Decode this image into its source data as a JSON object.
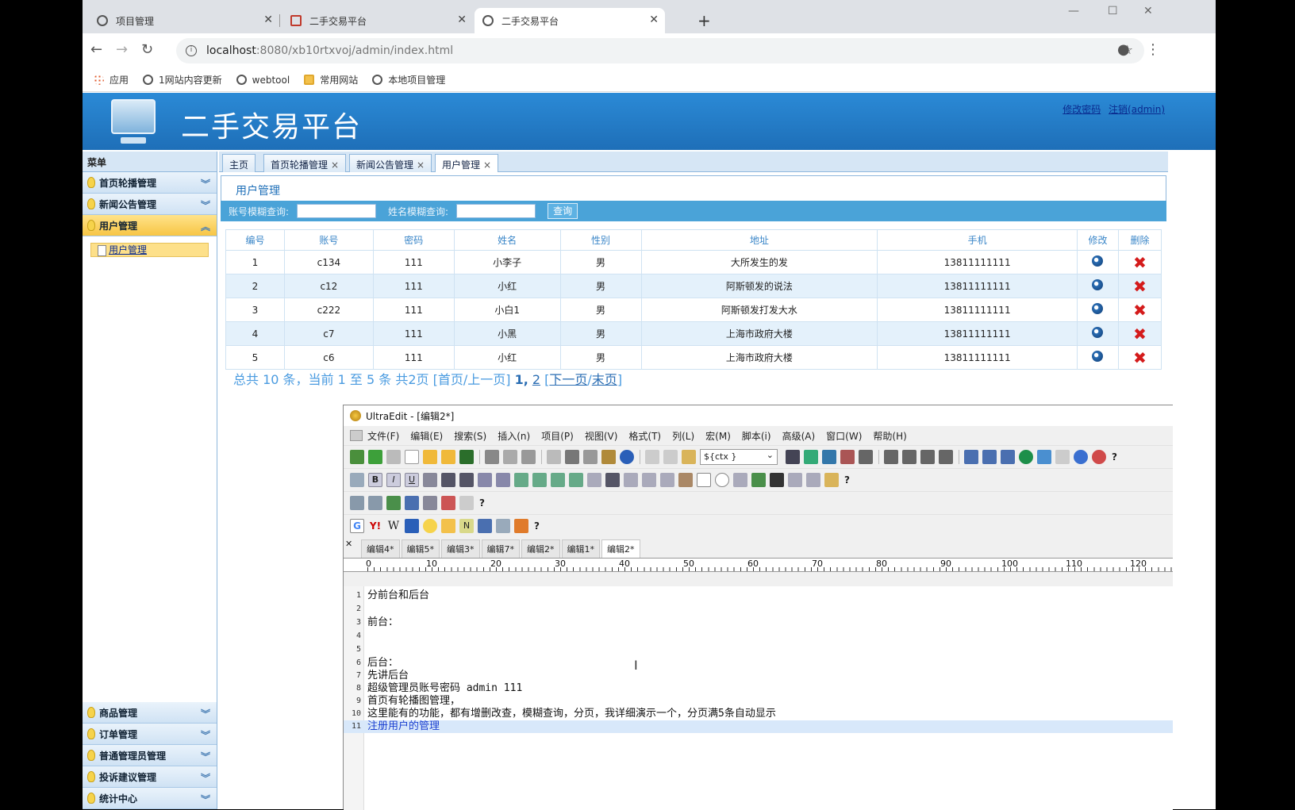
{
  "browser": {
    "tabs": [
      {
        "title": "项目管理"
      },
      {
        "title": "二手交易平台"
      },
      {
        "title": "二手交易平台"
      }
    ],
    "url_host": "localhost",
    "url_path": ":8080/xb10rtxvoj/admin/index.html",
    "bookmarks": [
      "应用",
      "1网站内容更新",
      "webtool",
      "常用网站",
      "本地项目管理"
    ]
  },
  "header": {
    "title": "二手交易平台",
    "link_change_password": "修改密码",
    "link_logout": "注销(admin)"
  },
  "sidebar": {
    "title": "菜单",
    "top_items": [
      {
        "label": "首页轮播管理"
      },
      {
        "label": "新闻公告管理"
      },
      {
        "label": "用户管理"
      }
    ],
    "sub_item": "用户管理",
    "bottom_items": [
      {
        "label": "商品管理"
      },
      {
        "label": "订单管理"
      },
      {
        "label": "普通管理员管理"
      },
      {
        "label": "投诉建议管理"
      },
      {
        "label": "统计中心"
      }
    ]
  },
  "page_tabs": [
    {
      "label": "主页"
    },
    {
      "label": "首页轮播管理"
    },
    {
      "label": "新闻公告管理"
    },
    {
      "label": "用户管理"
    }
  ],
  "panel": {
    "title": "用户管理",
    "search_account_label": "账号模糊查询:",
    "search_name_label": "姓名模糊查询:",
    "search_button": "查询"
  },
  "table": {
    "headers": [
      "编号",
      "账号",
      "密码",
      "姓名",
      "性别",
      "地址",
      "手机",
      "修改",
      "删除"
    ],
    "rows": [
      [
        "1",
        "c134",
        "111",
        "小李子",
        "男",
        "大所发生的发",
        "13811111111"
      ],
      [
        "2",
        "c12",
        "111",
        "小红",
        "男",
        "阿斯顿发的说法",
        "13811111111"
      ],
      [
        "3",
        "c222",
        "111",
        "小白1",
        "男",
        "阿斯顿发打发大水",
        "13811111111"
      ],
      [
        "4",
        "c7",
        "111",
        "小黑",
        "男",
        "上海市政府大楼",
        "13811111111"
      ],
      [
        "5",
        "c6",
        "111",
        "小红",
        "男",
        "上海市政府大楼",
        "13811111111"
      ]
    ]
  },
  "pagination": {
    "summary": "总共 10 条，当前 1 至 5 条 共2页 [首页/上一页]",
    "page1": "1",
    "page2": "2",
    "next": "下一页",
    "last": "末页"
  },
  "ultraedit": {
    "title": "UltraEdit - [编辑2*]",
    "menu": [
      "文件(F)",
      "编辑(E)",
      "搜索(S)",
      "插入(n)",
      "项目(P)",
      "视图(V)",
      "格式(T)",
      "列(L)",
      "宏(M)",
      "脚本(i)",
      "高级(A)",
      "窗口(W)",
      "帮助(H)"
    ],
    "combo_value": "${ctx }",
    "tabs": [
      "编辑4*",
      "编辑5*",
      "编辑3*",
      "编辑7*",
      "编辑2*",
      "编辑1*",
      "编辑2*"
    ],
    "ruler_ticks": [
      "0",
      "10",
      "20",
      "30",
      "40",
      "50",
      "60",
      "70",
      "80",
      "90",
      "100",
      "110",
      "120"
    ],
    "lines": [
      "分前台和后台",
      "",
      "前台：",
      "",
      "",
      "后台：",
      "先讲后台",
      "超级管理员账号密码 admin 111",
      "首页有轮播图管理，",
      "这里能有的功能，都有增删改查，模糊查询，分页，我详细演示一个，分页满5条自动显示",
      "注册用户的管理"
    ],
    "line_numbers": [
      "1",
      "2",
      "3",
      "4",
      "5",
      "6",
      "7",
      "8",
      "9",
      "10",
      "11"
    ]
  }
}
